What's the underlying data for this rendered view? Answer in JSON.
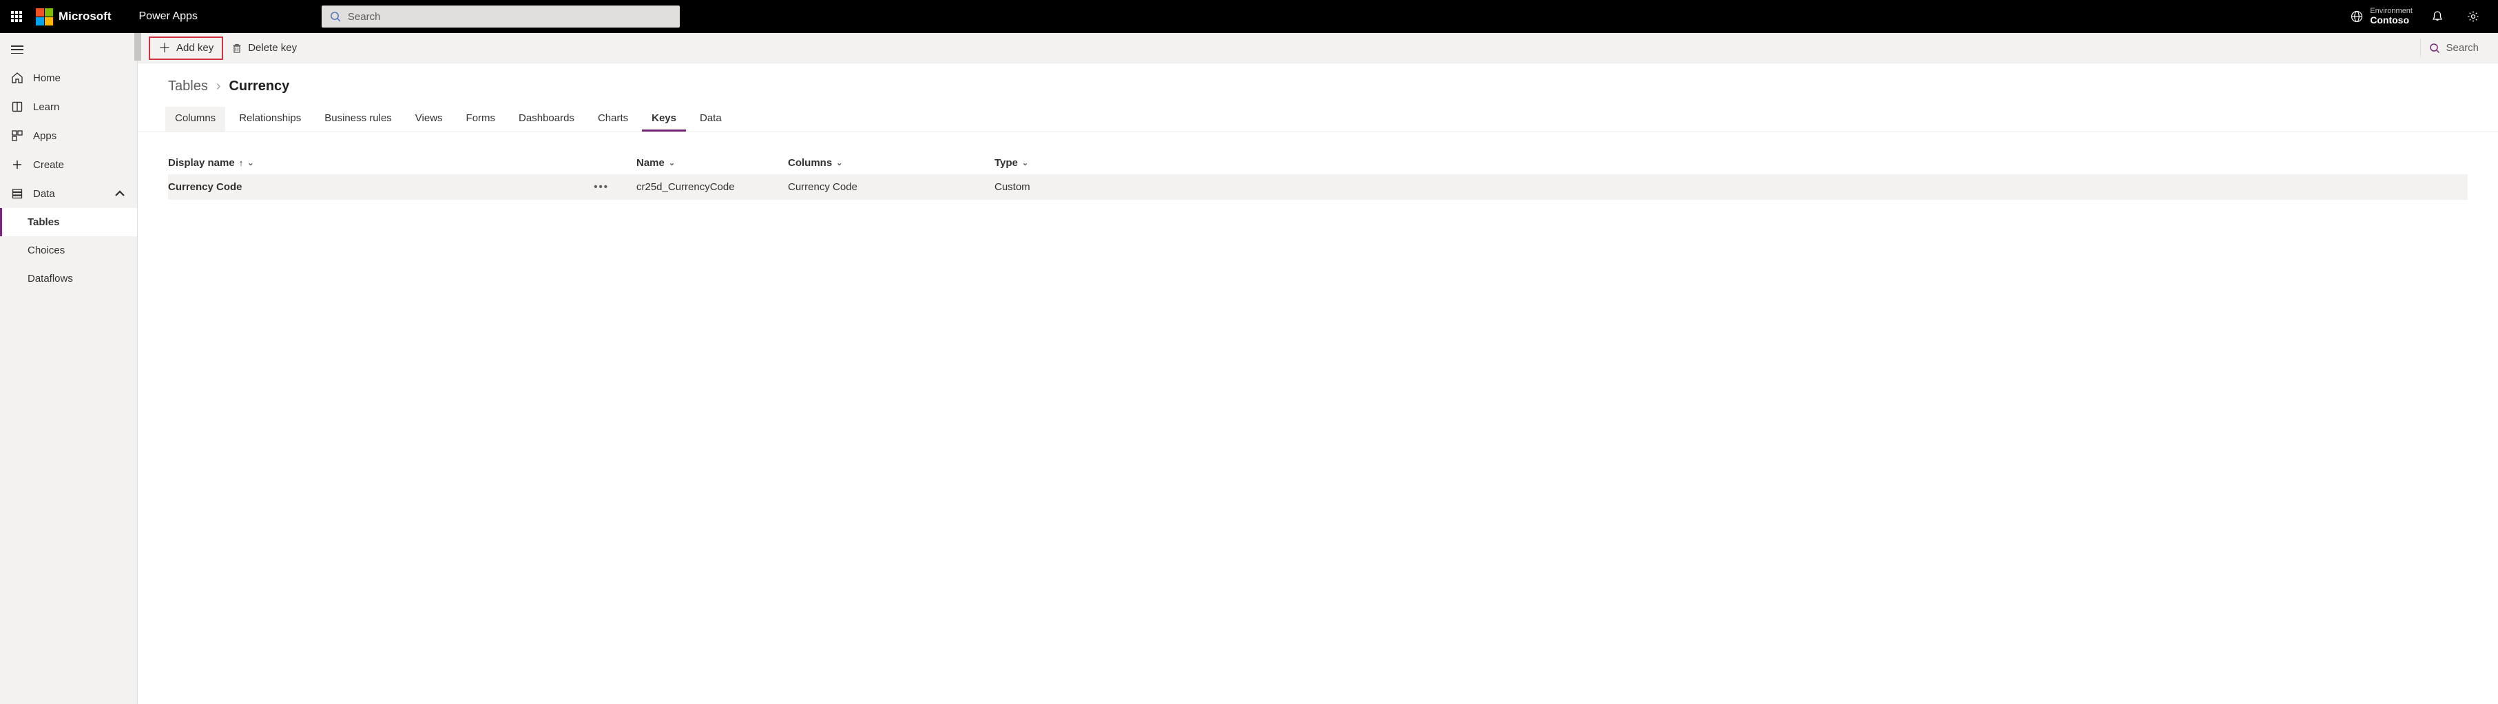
{
  "header": {
    "ms_brand": "Microsoft",
    "app_title": "Power Apps",
    "search_placeholder": "Search",
    "environment_label": "Environment",
    "environment_name": "Contoso"
  },
  "sidebar": {
    "home": "Home",
    "learn": "Learn",
    "apps": "Apps",
    "create": "Create",
    "data": "Data",
    "data_children": {
      "tables": "Tables",
      "choices": "Choices",
      "dataflows": "Dataflows"
    }
  },
  "command_bar": {
    "add_key": "Add key",
    "delete_key": "Delete key",
    "search": "Search"
  },
  "breadcrumb": {
    "parent": "Tables",
    "current": "Currency"
  },
  "tabs": {
    "columns": "Columns",
    "relationships": "Relationships",
    "business_rules": "Business rules",
    "views": "Views",
    "forms": "Forms",
    "dashboards": "Dashboards",
    "charts": "Charts",
    "keys": "Keys",
    "data": "Data"
  },
  "table": {
    "headers": {
      "display_name": "Display name",
      "name": "Name",
      "columns": "Columns",
      "type": "Type"
    },
    "rows": [
      {
        "display_name": "Currency Code",
        "name": "cr25d_CurrencyCode",
        "columns": "Currency Code",
        "type": "Custom"
      }
    ]
  }
}
